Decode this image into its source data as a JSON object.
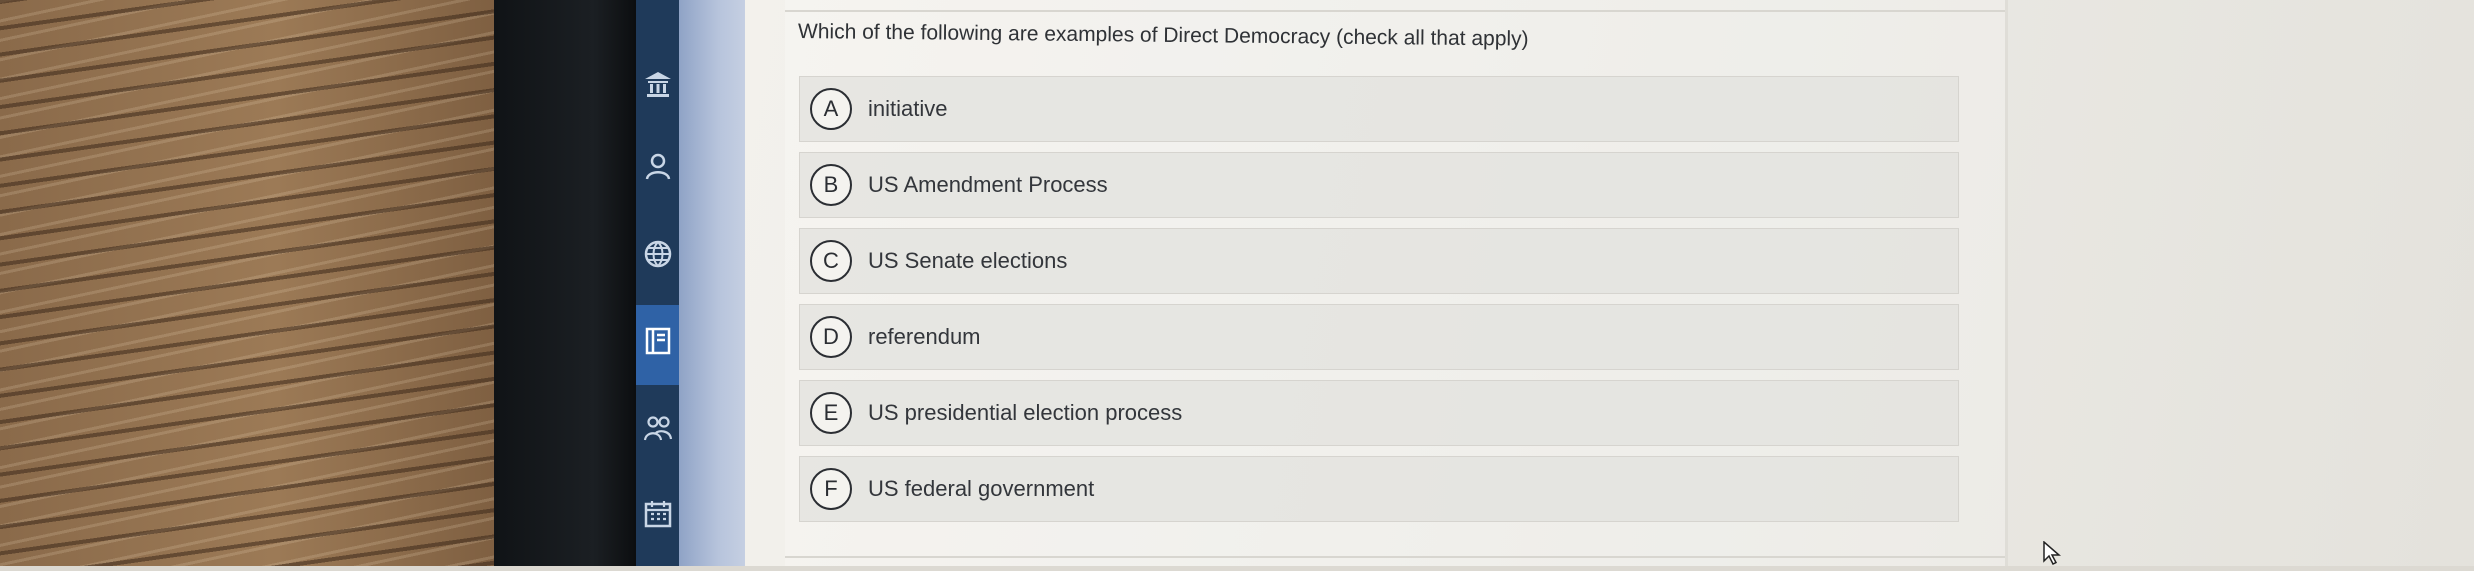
{
  "question": {
    "text": "Which of the following are examples of Direct Democracy (check all that apply)"
  },
  "options": [
    {
      "letter": "A",
      "label": "initiative"
    },
    {
      "letter": "B",
      "label": "US Amendment Process"
    },
    {
      "letter": "C",
      "label": "US Senate elections"
    },
    {
      "letter": "D",
      "label": "referendum"
    },
    {
      "letter": "E",
      "label": "US presidential election process"
    },
    {
      "letter": "F",
      "label": "US federal government"
    }
  ],
  "nav": {
    "items": [
      {
        "icon": "bank-icon"
      },
      {
        "icon": "person-icon"
      },
      {
        "icon": "globe-icon"
      },
      {
        "icon": "book-icon",
        "active": true
      },
      {
        "icon": "people-icon"
      },
      {
        "icon": "calendar-icon"
      }
    ]
  },
  "colors": {
    "nav_background": "#1f3a5a",
    "nav_active": "#2f62a6",
    "option_background": "#e2e1dd",
    "text": "#2f3236"
  }
}
